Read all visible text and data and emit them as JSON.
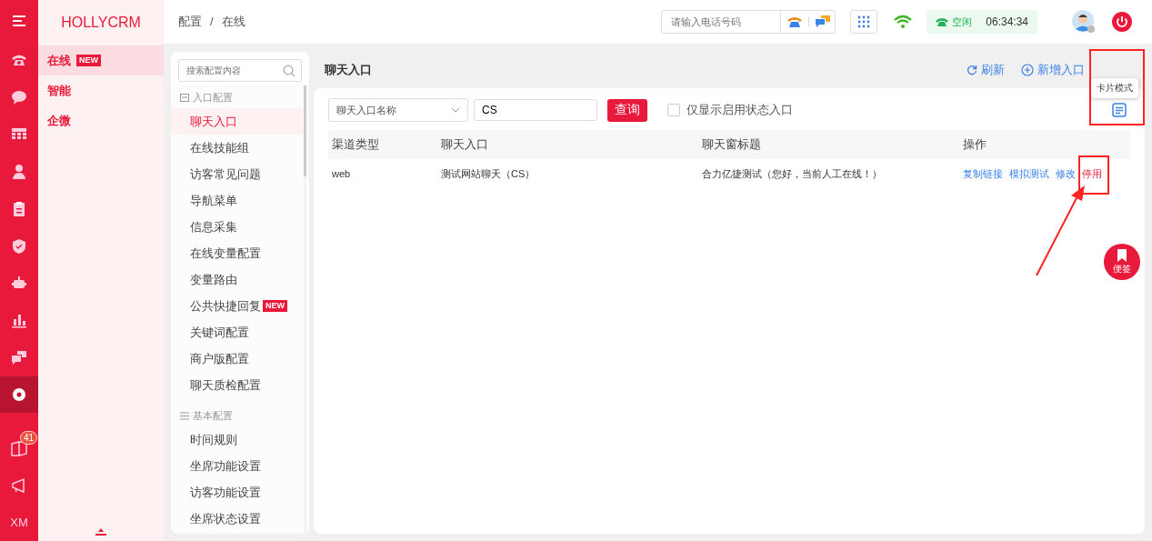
{
  "logo": "HOLLYCRM",
  "rail": [
    {
      "selected": false
    },
    {
      "selected": false
    },
    {
      "selected": false
    },
    {
      "selected": false
    },
    {
      "selected": false
    },
    {
      "selected": false
    },
    {
      "selected": false
    },
    {
      "selected": false
    },
    {
      "selected": false
    },
    {
      "selected": false
    },
    {
      "selected": true
    }
  ],
  "rail_bottom": {
    "badge": "41",
    "user_label": "XM"
  },
  "sidebar": [
    {
      "label": "在线",
      "selected": true,
      "badge": "NEW"
    },
    {
      "label": "智能",
      "selected": false
    },
    {
      "label": "企微",
      "selected": false
    }
  ],
  "breadcrumb": [
    "配置",
    "在线"
  ],
  "breadcrumb_separator": "/",
  "header": {
    "phone_placeholder": "请输入电话号码",
    "status": "空闲",
    "time": "06:34:34"
  },
  "config_menu": {
    "search_placeholder": "搜索配置内容",
    "groups": [
      {
        "title": "入口配置",
        "items": [
          {
            "label": "聊天入口",
            "selected": true
          },
          {
            "label": "在线技能组",
            "selected": false
          },
          {
            "label": "访客常见问题",
            "selected": false
          },
          {
            "label": "导航菜单",
            "selected": false
          },
          {
            "label": "信息采集",
            "selected": false
          },
          {
            "label": "在线变量配置",
            "selected": false
          },
          {
            "label": "变量路由",
            "selected": false
          },
          {
            "label": "公共快捷回复",
            "selected": false,
            "badge": "NEW"
          },
          {
            "label": "关键词配置",
            "selected": false
          },
          {
            "label": "商户版配置",
            "selected": false
          },
          {
            "label": "聊天质检配置",
            "selected": false
          }
        ]
      },
      {
        "title": "基本配置",
        "items": [
          {
            "label": "时间规则",
            "selected": false
          },
          {
            "label": "坐席功能设置",
            "selected": false
          },
          {
            "label": "访客功能设置",
            "selected": false
          },
          {
            "label": "坐席状态设置",
            "selected": false
          }
        ]
      }
    ]
  },
  "content": {
    "title": "聊天入口",
    "refresh": "刷新",
    "add": "新增入口",
    "tooltip": "卡片模式",
    "filter": {
      "select": "聊天入口名称",
      "value": "CS",
      "button": "查询",
      "checkbox_label": "仅显示启用状态入口",
      "checked": false
    },
    "columns": [
      "渠道类型",
      "聊天入口",
      "聊天窗标题",
      "操作"
    ],
    "rows": [
      {
        "cells": [
          "web",
          "测试网站聊天（CS）",
          "合力亿捷测试（您好，当前人工在线！）"
        ],
        "actions": [
          {
            "label": "复制链接",
            "kind": "link"
          },
          {
            "label": "模拟测试",
            "kind": "link"
          },
          {
            "label": "修改",
            "kind": "link"
          },
          {
            "label": "停用",
            "kind": "danger"
          }
        ]
      }
    ]
  },
  "note_button": "便签"
}
